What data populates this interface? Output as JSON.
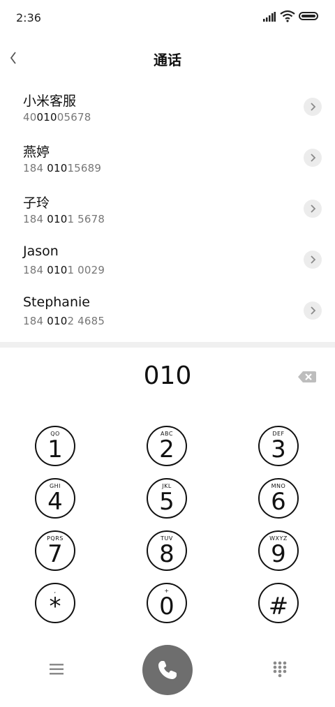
{
  "status_bar": {
    "time": "2:36"
  },
  "header": {
    "title": "通话"
  },
  "contacts": [
    {
      "name": "小米客服",
      "number_pre": "40",
      "number_match": "010",
      "number_post": "05678"
    },
    {
      "name": "燕婷",
      "number_pre": "184 ",
      "number_match": "010",
      "number_post": "15689"
    },
    {
      "name": "子玲",
      "number_pre": "184 ",
      "number_match": "010",
      "number_post": "1 5678"
    },
    {
      "name": "Jason",
      "number_pre": "184 ",
      "number_match": "010",
      "number_post": "1 0029"
    },
    {
      "name": "Stephanie",
      "number_pre": "184 ",
      "number_match": "010",
      "number_post": "2 4685"
    }
  ],
  "dialer": {
    "digits": "010"
  },
  "keypad": [
    {
      "digit": "1",
      "letters": "QO"
    },
    {
      "digit": "2",
      "letters": "ABC"
    },
    {
      "digit": "3",
      "letters": "DEF"
    },
    {
      "digit": "4",
      "letters": "GHI"
    },
    {
      "digit": "5",
      "letters": "JKL"
    },
    {
      "digit": "6",
      "letters": "MNO"
    },
    {
      "digit": "7",
      "letters": "PQRS"
    },
    {
      "digit": "8",
      "letters": "TUV"
    },
    {
      "digit": "9",
      "letters": "WXYZ"
    },
    {
      "digit": "*",
      "letters": ","
    },
    {
      "digit": "0",
      "letters": "+"
    },
    {
      "digit": "#",
      "letters": ""
    }
  ],
  "icons": {
    "back": "chevron-left-icon",
    "backspace": "backspace-icon",
    "menu": "menu-icon",
    "call": "phone-icon",
    "dialpad": "dialpad-icon"
  },
  "colors": {
    "call_button": "#6e6e6e",
    "match_text": "#111111",
    "secondary_text": "#777777"
  }
}
